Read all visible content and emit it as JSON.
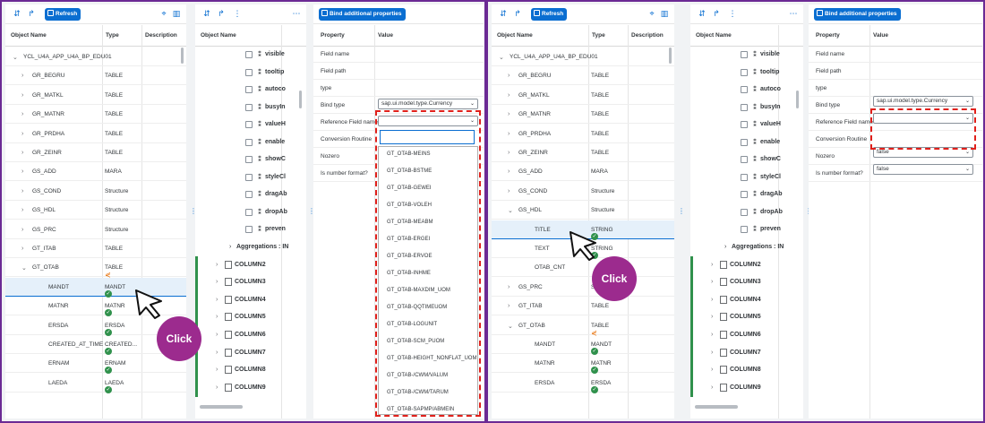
{
  "toolbar": {
    "refresh_label": "Refresh",
    "bind_label": "Bind additional properties"
  },
  "tree_headers": {
    "object_name": "Object Name",
    "type": "Type",
    "description": "Description"
  },
  "left_tree": [
    {
      "name": "YCL_U4A_APP_U4A_BP_EDU01",
      "type": "",
      "chev": "⌄",
      "indent": 0
    },
    {
      "name": "GR_BEGRU",
      "type": "TABLE",
      "chev": "›",
      "indent": 1
    },
    {
      "name": "GR_MATKL",
      "type": "TABLE",
      "chev": "›",
      "indent": 1
    },
    {
      "name": "GR_MATNR",
      "type": "TABLE",
      "chev": "›",
      "indent": 1
    },
    {
      "name": "GR_PRDHA",
      "type": "TABLE",
      "chev": "›",
      "indent": 1
    },
    {
      "name": "GR_ZEINR",
      "type": "TABLE",
      "chev": "›",
      "indent": 1
    },
    {
      "name": "GS_ADD",
      "type": "MARA",
      "chev": "›",
      "indent": 1
    },
    {
      "name": "GS_COND",
      "type": "Structure",
      "chev": "›",
      "indent": 1
    },
    {
      "name": "GS_HDL",
      "type": "Structure",
      "chev": "›",
      "indent": 1
    },
    {
      "name": "GS_PRC",
      "type": "Structure",
      "chev": "›",
      "indent": 1
    },
    {
      "name": "GT_ITAB",
      "type": "TABLE",
      "chev": "›",
      "indent": 1
    },
    {
      "name": "GT_OTAB",
      "type": "TABLE",
      "chev": "⌄",
      "indent": 1,
      "share": true
    },
    {
      "name": "MANDT",
      "type": "MANDT",
      "chev": "",
      "indent": 2,
      "check": true,
      "selected": true
    },
    {
      "name": "MATNR",
      "type": "MATNR",
      "chev": "",
      "indent": 2,
      "check": true
    },
    {
      "name": "ERSDA",
      "type": "ERSDA",
      "chev": "",
      "indent": 2,
      "check": true
    },
    {
      "name": "CREATED_AT_TIME",
      "type": "CREATED...",
      "chev": "",
      "indent": 2,
      "check": true
    },
    {
      "name": "ERNAM",
      "type": "ERNAM",
      "chev": "",
      "indent": 2,
      "check": true
    },
    {
      "name": "LAEDA",
      "type": "LAEDA",
      "chev": "",
      "indent": 2,
      "check": true
    }
  ],
  "right_tree": [
    {
      "name": "YCL_U4A_APP_U4A_BP_EDU01",
      "type": "",
      "chev": "⌄",
      "indent": 0
    },
    {
      "name": "GR_BEGRU",
      "type": "TABLE",
      "chev": "›",
      "indent": 1
    },
    {
      "name": "GR_MATKL",
      "type": "TABLE",
      "chev": "›",
      "indent": 1
    },
    {
      "name": "GR_MATNR",
      "type": "TABLE",
      "chev": "›",
      "indent": 1
    },
    {
      "name": "GR_PRDHA",
      "type": "TABLE",
      "chev": "›",
      "indent": 1
    },
    {
      "name": "GR_ZEINR",
      "type": "TABLE",
      "chev": "›",
      "indent": 1
    },
    {
      "name": "GS_ADD",
      "type": "MARA",
      "chev": "›",
      "indent": 1
    },
    {
      "name": "GS_COND",
      "type": "Structure",
      "chev": "›",
      "indent": 1
    },
    {
      "name": "GS_HDL",
      "type": "Structure",
      "chev": "⌄",
      "indent": 1
    },
    {
      "name": "TITLE",
      "type": "STRING",
      "chev": "",
      "indent": 2,
      "check": true,
      "selected": true
    },
    {
      "name": "TEXT",
      "type": "STRING",
      "chev": "",
      "indent": 2,
      "check": true
    },
    {
      "name": "OTAB_CNT",
      "type": "",
      "chev": "",
      "indent": 2
    },
    {
      "name": "GS_PRC",
      "type": "Structure",
      "chev": "›",
      "indent": 1
    },
    {
      "name": "GT_ITAB",
      "type": "TABLE",
      "chev": "›",
      "indent": 1
    },
    {
      "name": "GT_OTAB",
      "type": "TABLE",
      "chev": "⌄",
      "indent": 1,
      "share": true
    },
    {
      "name": "MANDT",
      "type": "MANDT",
      "chev": "",
      "indent": 2,
      "check": true
    },
    {
      "name": "MATNR",
      "type": "MATNR",
      "chev": "",
      "indent": 2,
      "check": true
    },
    {
      "name": "ERSDA",
      "type": "ERSDA",
      "chev": "",
      "indent": 2,
      "check": true
    }
  ],
  "left_nodes": {
    "props": [
      "visible",
      "tooltip",
      "autoco",
      "busyIn",
      "valueH",
      "enable",
      "showC",
      "styleCl",
      "dragAb",
      "dropAb",
      "preven"
    ],
    "aggregations": "Aggregations : IN",
    "columns": [
      "COLUMN2",
      "COLUMN3",
      "COLUMN4",
      "COLUMN5",
      "COLUMN6",
      "COLUMN7",
      "COLUMN8",
      "COLUMN9"
    ]
  },
  "right_nodes": {
    "props": [
      "visible",
      "tooltip",
      "autoco",
      "busyIn",
      "valueH",
      "enable",
      "showC",
      "styleCl",
      "dragAb",
      "dropAb",
      "preven"
    ],
    "aggregations": "Aggregations : IN",
    "columns": [
      "COLUMN2",
      "COLUMN3",
      "COLUMN4",
      "COLUMN5",
      "COLUMN6",
      "COLUMN7",
      "COLUMN8",
      "COLUMN9"
    ]
  },
  "prop_headers": {
    "property": "Property",
    "value": "Value"
  },
  "left_props": [
    {
      "label": "Field name",
      "value": ""
    },
    {
      "label": "Field path",
      "value": ""
    },
    {
      "label": "type",
      "value": ""
    },
    {
      "label": "Bind type",
      "value": "sap.ui.model.type.Currency"
    },
    {
      "label": "Reference Field name",
      "value": ""
    },
    {
      "label": "Conversion Routine",
      "value": ""
    },
    {
      "label": "Nozero",
      "value": ""
    },
    {
      "label": "Is number format?",
      "value": ""
    }
  ],
  "right_props": [
    {
      "label": "Field name",
      "value": ""
    },
    {
      "label": "Field path",
      "value": ""
    },
    {
      "label": "type",
      "value": ""
    },
    {
      "label": "Bind type",
      "value": "sap.ui.model.type.Currency"
    },
    {
      "label": "Reference Field name",
      "value": ""
    },
    {
      "label": "Conversion Routine",
      "value": ""
    },
    {
      "label": "Nozero",
      "value": "false"
    },
    {
      "label": "Is number format?",
      "value": "false"
    }
  ],
  "dropdown_options": [
    "GT_OTAB-MEINS",
    "GT_OTAB-BSTME",
    "GT_OTAB-GEWEI",
    "GT_OTAB-VOLEH",
    "GT_OTAB-MEABM",
    "GT_OTAB-ERGEI",
    "GT_OTAB-ERVOE",
    "GT_OTAB-INHME",
    "GT_OTAB-MAXDIM_UOM",
    "GT_OTAB-QQTIMEUOM",
    "GT_OTAB-LOGUNIT",
    "GT_OTAB-SCM_PUOM",
    "GT_OTAB-HEIGHT_NONFLAT_UOM",
    "GT_OTAB-/CWM/VALUM",
    "GT_OTAB-/CWM/TARUM",
    "GT_OTAB-SAPMP/ABMEIN"
  ],
  "annotations": {
    "click_left": "Click",
    "click_right": "Click"
  }
}
